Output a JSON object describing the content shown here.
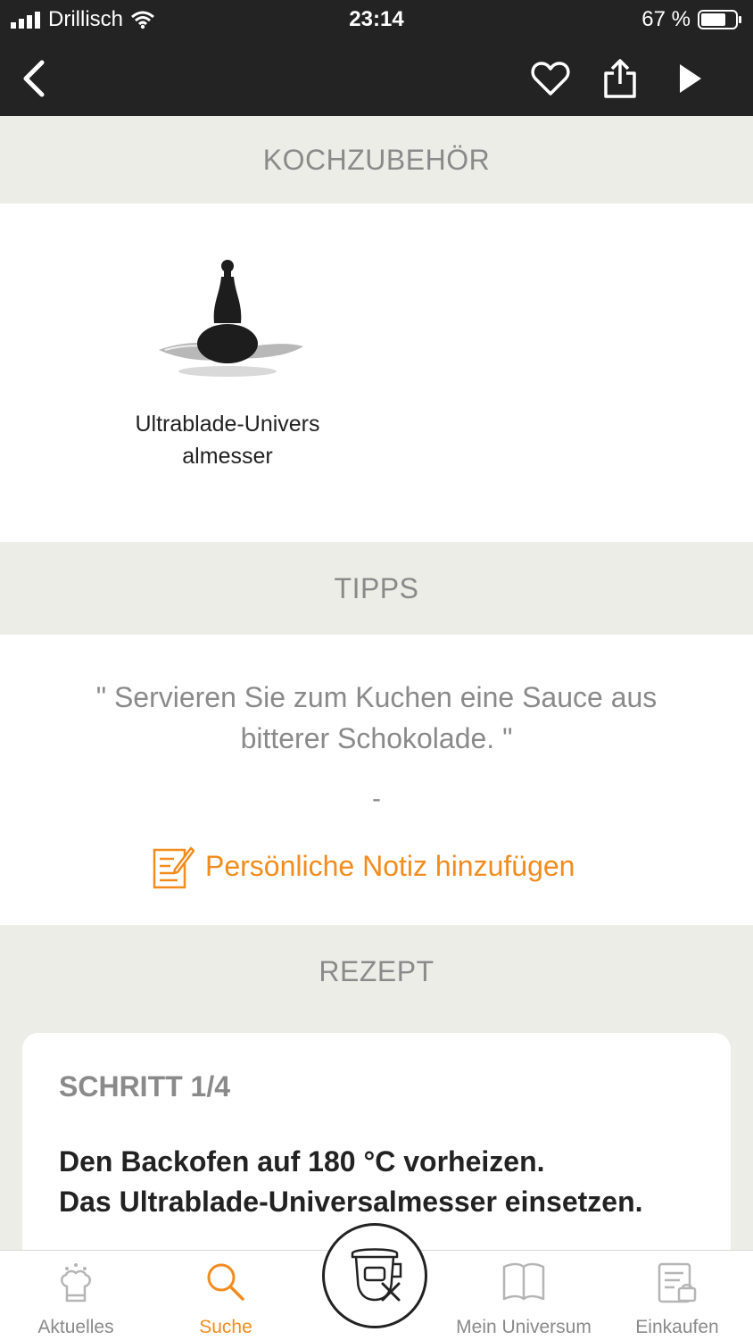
{
  "status_bar": {
    "carrier": "Drillisch",
    "time": "23:14",
    "battery": "67 %"
  },
  "toolbar": {
    "back_icon": "chevron-left-icon",
    "favorite_icon": "heart-icon",
    "share_icon": "share-icon",
    "play_icon": "play-icon"
  },
  "sections": {
    "accessories_title": "KOCHZUBEHÖR",
    "tips_title": "TIPPS",
    "recipe_title": "REZEPT"
  },
  "accessory": {
    "name": "Ultrablade-Universalmesser",
    "icon": "blade-image"
  },
  "tip": {
    "text": "\" Servieren Sie zum Kuchen eine Sauce aus bitterer Schokolade. \"",
    "dash": "-"
  },
  "note": {
    "label": "Persönliche Notiz hinzufügen",
    "icon": "note-edit-icon"
  },
  "step": {
    "label": "SCHRITT 1/4",
    "line1": "Den Backofen auf 180 °C vorheizen.",
    "line2": "Das Ultrablade-Universalmesser einsetzen."
  },
  "tabbar": {
    "items": [
      {
        "label": "Aktuelles",
        "icon": "chef-hat-icon"
      },
      {
        "label": "Suche",
        "icon": "search-icon",
        "active": true
      },
      {
        "label": "Mein Universum",
        "icon": "book-icon"
      },
      {
        "label": "Einkaufen",
        "icon": "shopping-list-icon"
      }
    ],
    "center_icon": "cooker-icon"
  },
  "colors": {
    "accent": "#f28c1e",
    "toolbar": "#232323",
    "section_bg": "#edede8",
    "muted_text": "#8a8a8a"
  }
}
